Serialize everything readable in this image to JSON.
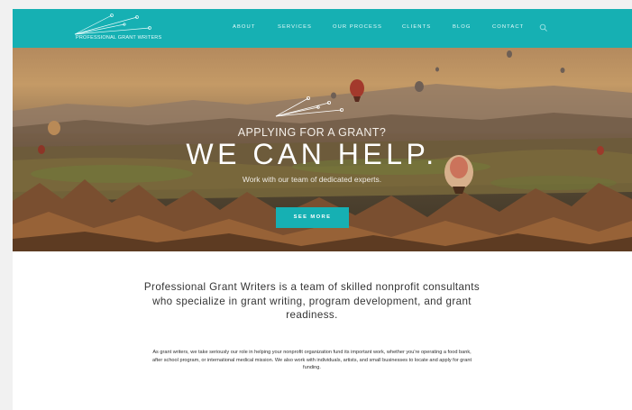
{
  "header": {
    "logo_text": "PROFESSIONAL GRANT WRITERS",
    "nav": [
      {
        "label": "ABOUT"
      },
      {
        "label": "SERVICES"
      },
      {
        "label": "OUR PROCESS"
      },
      {
        "label": "CLIENTS"
      },
      {
        "label": "BLOG"
      },
      {
        "label": "CONTACT"
      }
    ],
    "search_icon": "search-icon"
  },
  "hero": {
    "kicker": "APPLYING FOR A GRANT?",
    "title": "WE CAN HELP.",
    "subtitle": "Work with our team of dedicated experts.",
    "cta_label": "SEE MORE",
    "background": "hot air balloons over rocky valley landscape"
  },
  "content": {
    "intro": "Professional Grant Writers is a team of skilled nonprofit consultants who specialize in grant writing, program development, and grant readiness.",
    "detail": "As grant writers, we take seriously our role in helping your nonprofit organization fund its important work, whether you're operating a food bank, after school program, or international medical mission. We also work with individuals, artists, and small businesses to locate and apply for grant funding."
  },
  "colors": {
    "accent": "#16b0b3",
    "page_bg": "#f1f1f1",
    "text_dark": "#333333"
  }
}
